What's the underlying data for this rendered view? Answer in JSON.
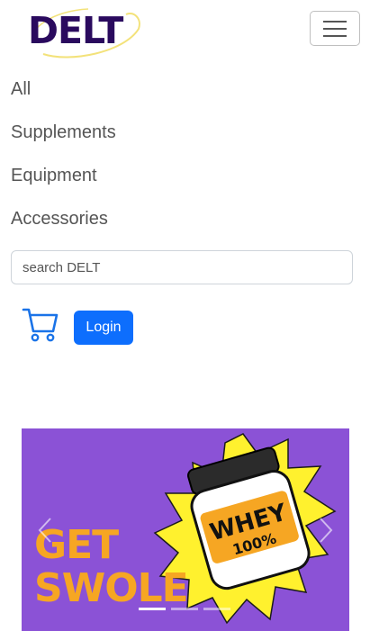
{
  "brand": {
    "logo_text": "DELT"
  },
  "nav": {
    "toggle_icon": "hamburger-icon",
    "items": [
      {
        "label": "All"
      },
      {
        "label": "Supplements"
      },
      {
        "label": "Equipment"
      },
      {
        "label": "Accessories"
      }
    ]
  },
  "search": {
    "placeholder": "search DELT",
    "value": ""
  },
  "cart": {
    "icon": "cart-icon"
  },
  "login": {
    "label": "Login"
  },
  "carousel": {
    "slide_text_line1": "GET",
    "slide_text_line2": "SWOLE",
    "jar_label_line1": "WHEY",
    "jar_label_line2": "100%",
    "prev_icon": "chevron-left-icon",
    "next_icon": "chevron-right-icon",
    "indicator_count": 3,
    "active_index": 0
  },
  "colors": {
    "brand_dark": "#2a0a5e",
    "primary": "#0d6efd",
    "banner_bg": "#8b52d6",
    "banner_text": "#f6a623",
    "starburst": "#fff12e"
  }
}
